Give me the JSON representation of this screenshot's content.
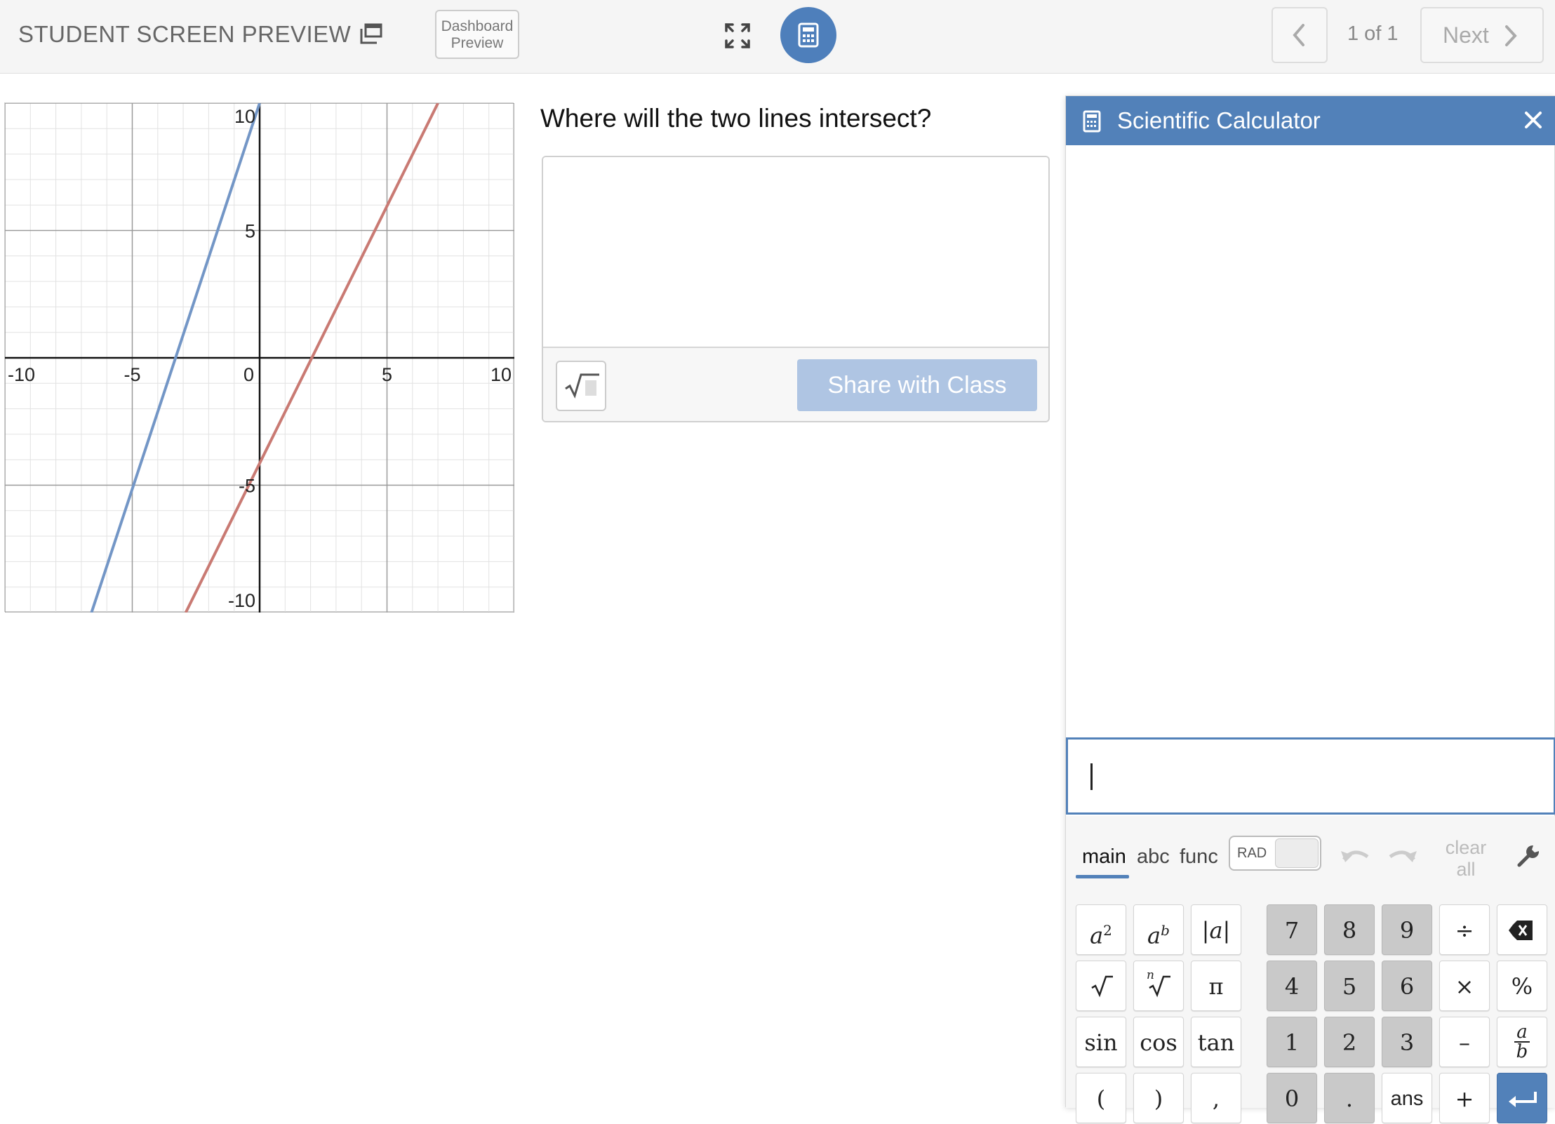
{
  "topbar": {
    "preview_title": "STUDENT SCREEN PREVIEW",
    "dashboard_btn_line1": "Dashboard",
    "dashboard_btn_line2": "Preview",
    "page_count": "1 of 1",
    "next_label": "Next"
  },
  "graph": {
    "x_ticks": [
      "-10",
      "-5",
      "0",
      "5",
      "10"
    ],
    "y_ticks": [
      "10",
      "5",
      "-5",
      "-10"
    ],
    "xlim": [
      -10,
      10
    ],
    "ylim": [
      -10,
      10
    ],
    "grid": true,
    "lines": [
      {
        "color": "#7396c6",
        "points": [
          [
            -6.6,
            -10
          ],
          [
            0,
            10
          ]
        ]
      },
      {
        "color": "#c97a73",
        "points": [
          [
            -2.9,
            -10
          ],
          [
            7.0,
            10
          ]
        ]
      }
    ]
  },
  "question": {
    "prompt": "Where will the two lines intersect?",
    "share_label": "Share with Class"
  },
  "calculator": {
    "title": "Scientific Calculator",
    "tabs": {
      "main": "main",
      "abc": "abc",
      "func": "func"
    },
    "angle_mode": "RAD",
    "clear_line1": "clear",
    "clear_line2": "all",
    "keys": {
      "sq_base": "a",
      "sq_exp": "2",
      "pow_base": "a",
      "pow_exp": "b",
      "abs": "|a|",
      "pi": "π",
      "sin": "sin",
      "cos": "cos",
      "tan": "tan",
      "lparen": "(",
      "rparen": ")",
      "comma": ",",
      "n7": "7",
      "n8": "8",
      "n9": "9",
      "n4": "4",
      "n5": "5",
      "n6": "6",
      "n1": "1",
      "n2": "2",
      "n3": "3",
      "n0": "0",
      "dot": ".",
      "ans": "ans",
      "divide": "÷",
      "times": "×",
      "minus": "–",
      "plus": "+",
      "percent": "%",
      "frac_num": "a",
      "frac_den": "b",
      "root_index": "n"
    }
  },
  "colors": {
    "accent": "#5281b9",
    "line1": "#7396c6",
    "line2": "#c97a73",
    "share_disabled": "#afc5e3"
  }
}
